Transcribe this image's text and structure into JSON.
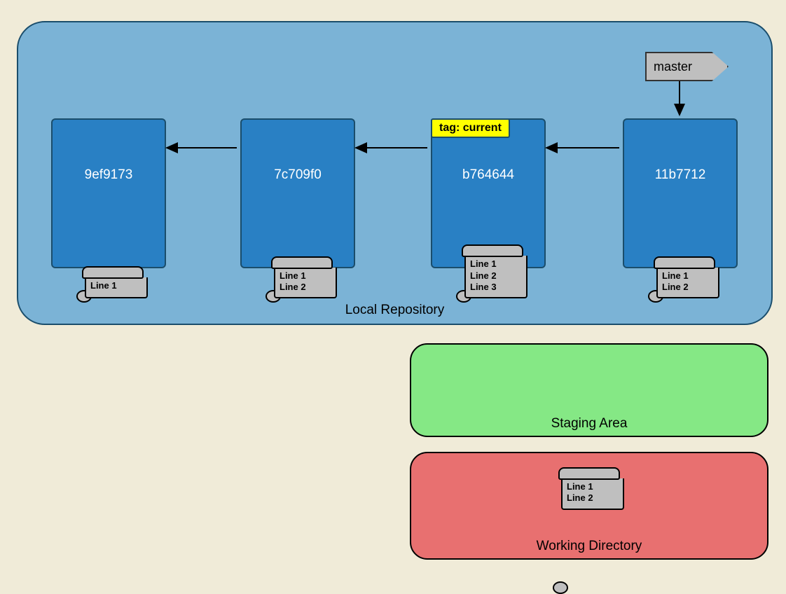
{
  "local_repo": {
    "label": "Local Repository",
    "master_label": "master",
    "commits": [
      {
        "id": "9ef9173",
        "scroll": "Line 1"
      },
      {
        "id": "7c709f0",
        "scroll": "Line 1\nLine 2"
      },
      {
        "id": "b764644",
        "scroll": "Line 1\nLine 2\nLine 3",
        "tag": "tag: current"
      },
      {
        "id": "11b7712",
        "scroll": "Line 1\nLine 2"
      }
    ]
  },
  "staging_area": {
    "label": "Staging Area"
  },
  "working_dir": {
    "label": "Working Directory",
    "scroll": "Line 1\nLine 2"
  }
}
